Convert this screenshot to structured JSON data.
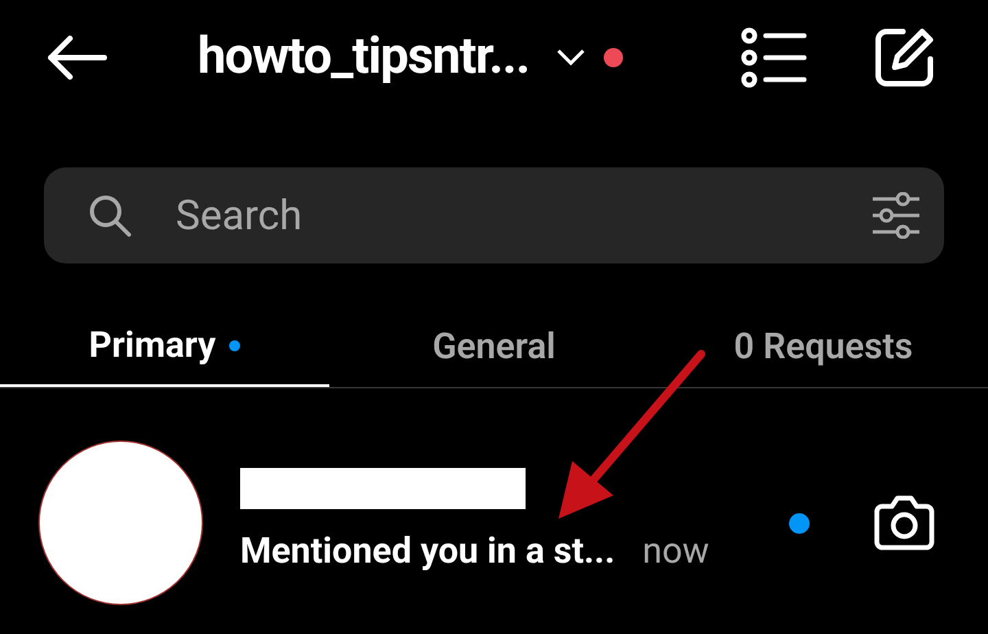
{
  "header": {
    "title": "howto_tipsntr...",
    "has_notification": true
  },
  "search": {
    "placeholder": "Search"
  },
  "tabs": [
    {
      "label": "Primary",
      "selected": true,
      "unread": true
    },
    {
      "label": "General",
      "selected": false,
      "unread": false
    },
    {
      "label": "0 Requests",
      "selected": false,
      "unread": false
    }
  ],
  "threads": [
    {
      "message": "Mentioned you in a st...",
      "time": "now",
      "unread": true
    }
  ]
}
